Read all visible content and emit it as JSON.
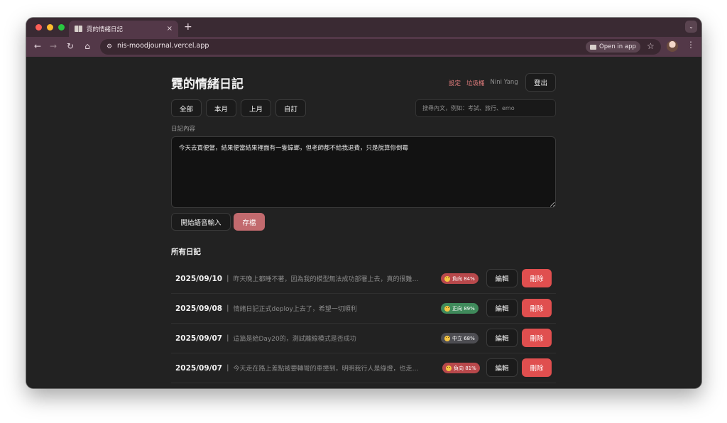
{
  "browser": {
    "tab_title": "霓的情緒日記",
    "tab_close": "×",
    "new_tab": "+",
    "tab_menu": "⌄",
    "url": "nis-moodjournal.vercel.app",
    "open_in_app": "Open in app",
    "nav": {
      "back": "←",
      "forward": "→",
      "reload": "↻",
      "home": "⌂",
      "star": "☆",
      "menu": "⋮",
      "site_info": "⚙"
    }
  },
  "header": {
    "title": "霓的情緒日記",
    "settings": "設定",
    "trash": "垃圾桶",
    "user": "Nini Yang",
    "logout": "登出"
  },
  "filters": [
    "全部",
    "本月",
    "上月",
    "自訂"
  ],
  "search": {
    "placeholder": "搜尋內文，例如：考試、旅行、emo",
    "value": ""
  },
  "editor": {
    "label": "日記內容",
    "value": "今天去買便當，結果便當結果裡面有一隻蟑螂，但老師都不給我退費，只是說算你倒霉"
  },
  "actions": {
    "voice": "開始語音輸入",
    "save": "存檔"
  },
  "entries_section": {
    "title": "所有日記",
    "separator": "|",
    "edit_label": "編輯",
    "delete_label": "刪除",
    "entries": [
      {
        "date": "2025/09/10",
        "text": "昨天晚上都睡不著，因為我的模型無法成功部署上去，真的很難…",
        "sentiment": "負向 84%",
        "color": "#b8484b"
      },
      {
        "date": "2025/09/08",
        "text": "情緒日記正式deploy上去了，希望一切順利",
        "sentiment": "正向 89%",
        "color": "#3f8a5b"
      },
      {
        "date": "2025/09/07",
        "text": "這篇是給Day20的，測試離線模式是否成功",
        "sentiment": "中立 68%",
        "color": "#4d4d52"
      },
      {
        "date": "2025/09/07",
        "text": "今天走在路上差點被要轉彎的車撞到，明明我行人是綠燈，也走…",
        "sentiment": "負向 81%",
        "color": "#b8484b"
      }
    ]
  },
  "icons": {
    "tab_favicon": "book-icon",
    "sentiment_face": "emoji-face-icon"
  }
}
